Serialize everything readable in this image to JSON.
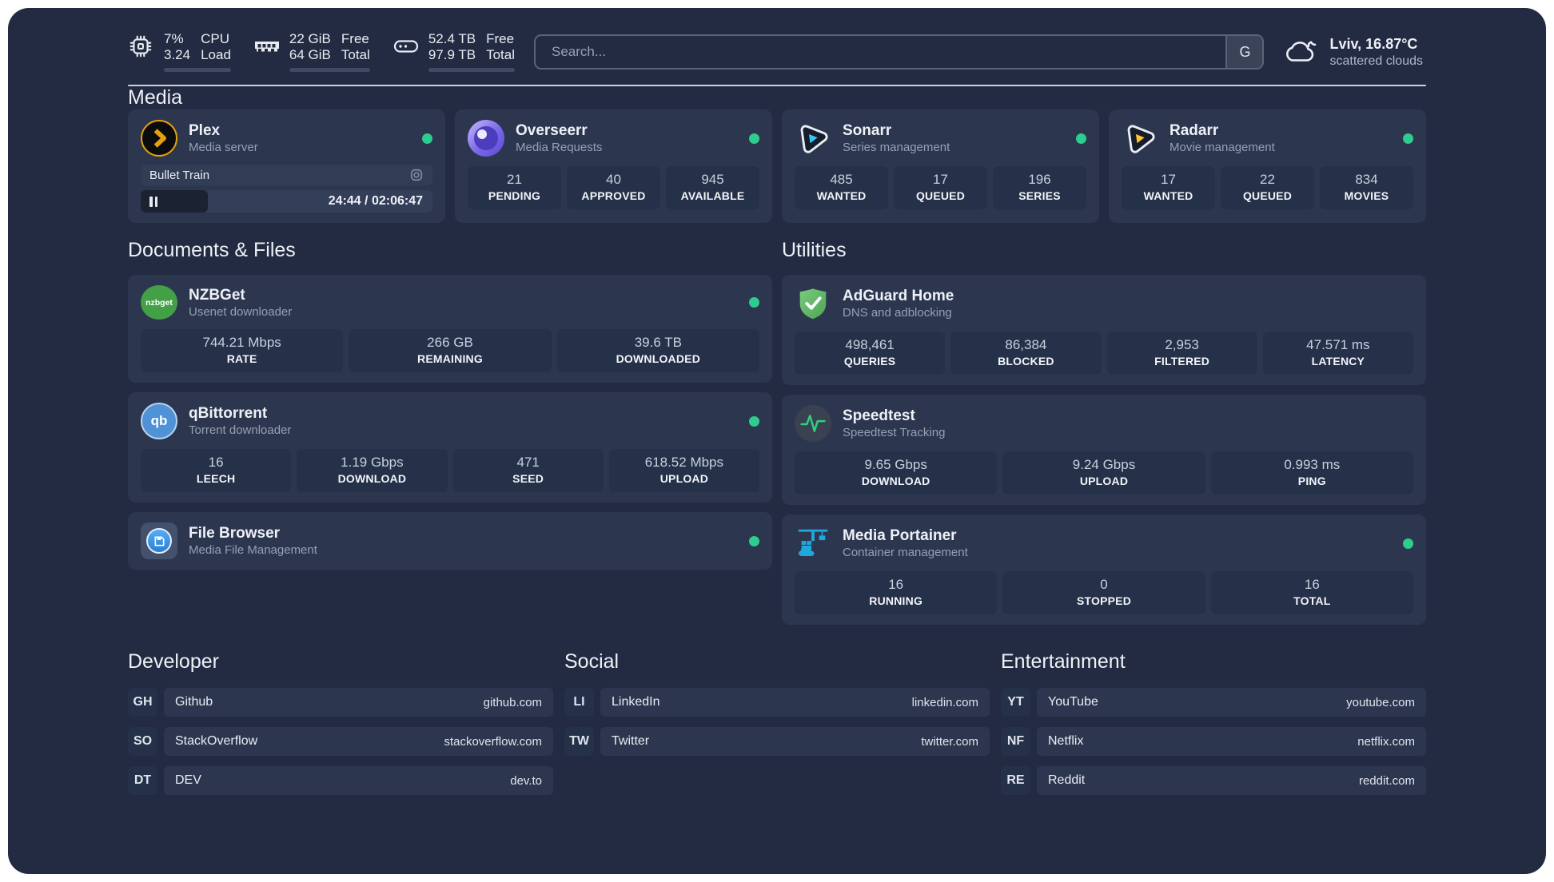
{
  "topbar": {
    "metrics": [
      {
        "icon": "cpu-icon",
        "rows": [
          {
            "value": "7%",
            "label": "CPU"
          },
          {
            "value": "3.24",
            "label": "Load"
          }
        ],
        "progress_pct": 22
      },
      {
        "icon": "ram-icon",
        "rows": [
          {
            "value": "22 GiB",
            "label": "Free"
          },
          {
            "value": "64 GiB",
            "label": "Total"
          }
        ],
        "progress_pct": 66
      },
      {
        "icon": "disk-icon",
        "rows": [
          {
            "value": "52.4 TB",
            "label": "Free"
          },
          {
            "value": "97.9 TB",
            "label": "Total"
          }
        ],
        "progress_pct": 47
      }
    ],
    "search": {
      "placeholder": "Search...",
      "engine_button": "G"
    },
    "weather": {
      "icon": "cloud-icon",
      "title": "Lviv, 16.87°C",
      "subtitle": "scattered clouds"
    }
  },
  "sections": {
    "media": "Media",
    "documents": "Documents & Files",
    "utilities": "Utilities",
    "developer": "Developer",
    "social": "Social",
    "entertainment": "Entertainment"
  },
  "colors": {
    "accent_green": "#2ECC8F",
    "page_bg": "#222B42",
    "card_bg": "#2C374F"
  },
  "apps": {
    "plex": {
      "icon": "plex-icon",
      "title": "Plex",
      "subtitle": "Media server",
      "online": true,
      "now_playing": {
        "title": "Bullet Train",
        "state": "paused",
        "time": "24:44 / 02:06:47",
        "progress_pct": 20
      }
    },
    "overseerr": {
      "icon": "overseerr-icon",
      "title": "Overseerr",
      "subtitle": "Media Requests",
      "online": true,
      "stats": [
        {
          "value": "21",
          "label": "PENDING"
        },
        {
          "value": "40",
          "label": "APPROVED"
        },
        {
          "value": "945",
          "label": "AVAILABLE"
        }
      ]
    },
    "sonarr": {
      "icon": "sonarr-icon",
      "title": "Sonarr",
      "subtitle": "Series management",
      "online": true,
      "stats": [
        {
          "value": "485",
          "label": "WANTED"
        },
        {
          "value": "17",
          "label": "QUEUED"
        },
        {
          "value": "196",
          "label": "SERIES"
        }
      ]
    },
    "radarr": {
      "icon": "radarr-icon",
      "title": "Radarr",
      "subtitle": "Movie management",
      "online": true,
      "stats": [
        {
          "value": "17",
          "label": "WANTED"
        },
        {
          "value": "22",
          "label": "QUEUED"
        },
        {
          "value": "834",
          "label": "MOVIES"
        }
      ]
    },
    "nzbget": {
      "icon": "nzbget-icon",
      "title": "NZBGet",
      "subtitle": "Usenet downloader",
      "online": true,
      "icon_text": "nzbget",
      "stats": [
        {
          "value": "744.21 Mbps",
          "label": "RATE"
        },
        {
          "value": "266 GB",
          "label": "REMAINING"
        },
        {
          "value": "39.6 TB",
          "label": "DOWNLOADED"
        }
      ]
    },
    "qbittorrent": {
      "icon": "qbittorrent-icon",
      "title": "qBittorrent",
      "subtitle": "Torrent downloader",
      "online": true,
      "icon_text": "qb",
      "stats": [
        {
          "value": "16",
          "label": "LEECH"
        },
        {
          "value": "1.19 Gbps",
          "label": "DOWNLOAD"
        },
        {
          "value": "471",
          "label": "SEED"
        },
        {
          "value": "618.52 Mbps",
          "label": "UPLOAD"
        }
      ]
    },
    "filebrowser": {
      "icon": "filebrowser-icon",
      "title": "File Browser",
      "subtitle": "Media File Management",
      "online": true
    },
    "adguard": {
      "icon": "adguard-icon",
      "title": "AdGuard Home",
      "subtitle": "DNS and adblocking",
      "stats": [
        {
          "value": "498,461",
          "label": "QUERIES"
        },
        {
          "value": "86,384",
          "label": "BLOCKED"
        },
        {
          "value": "2,953",
          "label": "FILTERED"
        },
        {
          "value": "47.571 ms",
          "label": "LATENCY"
        }
      ]
    },
    "speedtest": {
      "icon": "speedtest-icon",
      "title": "Speedtest",
      "subtitle": "Speedtest Tracking",
      "stats": [
        {
          "value": "9.65 Gbps",
          "label": "DOWNLOAD"
        },
        {
          "value": "9.24 Gbps",
          "label": "UPLOAD"
        },
        {
          "value": "0.993 ms",
          "label": "PING"
        }
      ]
    },
    "portainer": {
      "icon": "portainer-icon",
      "title": "Media Portainer",
      "subtitle": "Container management",
      "online": true,
      "stats": [
        {
          "value": "16",
          "label": "RUNNING"
        },
        {
          "value": "0",
          "label": "STOPPED"
        },
        {
          "value": "16",
          "label": "TOTAL"
        }
      ]
    }
  },
  "links": {
    "developer": [
      {
        "abbr": "GH",
        "name": "Github",
        "url": "github.com"
      },
      {
        "abbr": "SO",
        "name": "StackOverflow",
        "url": "stackoverflow.com"
      },
      {
        "abbr": "DT",
        "name": "DEV",
        "url": "dev.to"
      }
    ],
    "social": [
      {
        "abbr": "LI",
        "name": "LinkedIn",
        "url": "linkedin.com"
      },
      {
        "abbr": "TW",
        "name": "Twitter",
        "url": "twitter.com"
      }
    ],
    "entertainment": [
      {
        "abbr": "YT",
        "name": "YouTube",
        "url": "youtube.com"
      },
      {
        "abbr": "NF",
        "name": "Netflix",
        "url": "netflix.com"
      },
      {
        "abbr": "RE",
        "name": "Reddit",
        "url": "reddit.com"
      }
    ]
  }
}
